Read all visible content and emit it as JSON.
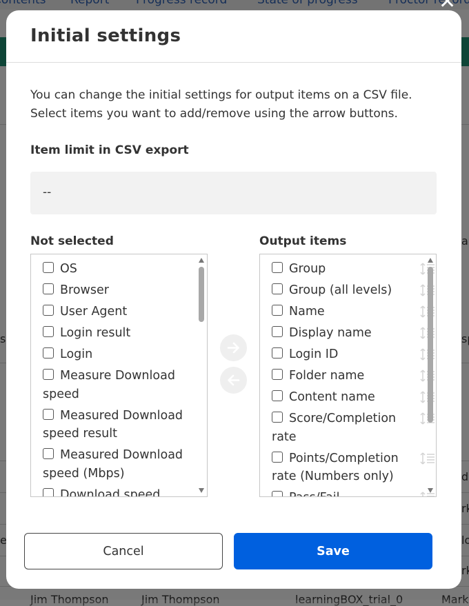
{
  "background": {
    "tabs": [
      "Contents",
      "Report",
      "Progress record",
      "State of progress",
      "Proctor record"
    ],
    "cells": [
      "ar",
      "sc",
      "sp",
      "d",
      "rk",
      "e.",
      "lo",
      "rk",
      "Jim Thompson",
      "Jim Thompson",
      "learningBOX_trial_0",
      "Mark"
    ]
  },
  "modal": {
    "title": "Initial settings",
    "description": "You can change the initial settings for output items on a CSV file. Select items you want to add/remove using the arrow buttons.",
    "limit_label": "Item limit in CSV export",
    "limit_value": "--",
    "not_selected_label": "Not selected",
    "output_label": "Output items",
    "not_selected_items": [
      "OS",
      "Browser",
      "User Agent",
      "Login result",
      "Login",
      "Measure Download speed",
      "Measured Download speed result",
      "Measured Download speed (Mbps)",
      "Download speed"
    ],
    "output_items": [
      "Group",
      "Group (all levels)",
      "Name",
      "Display name",
      "Login ID",
      "Folder name",
      "Content name",
      "Score/Completion rate",
      "Points/Completion rate (Numbers only)",
      "Pass/Fail"
    ],
    "buttons": {
      "cancel": "Cancel",
      "save": "Save"
    }
  },
  "colors": {
    "primary": "#0060df",
    "overlay": "rgba(0,0,0,0.5)"
  },
  "icons": {
    "move_right": "arrow-right-icon",
    "move_left": "arrow-left-icon",
    "reorder": "sort-icon",
    "close": "close-icon"
  }
}
